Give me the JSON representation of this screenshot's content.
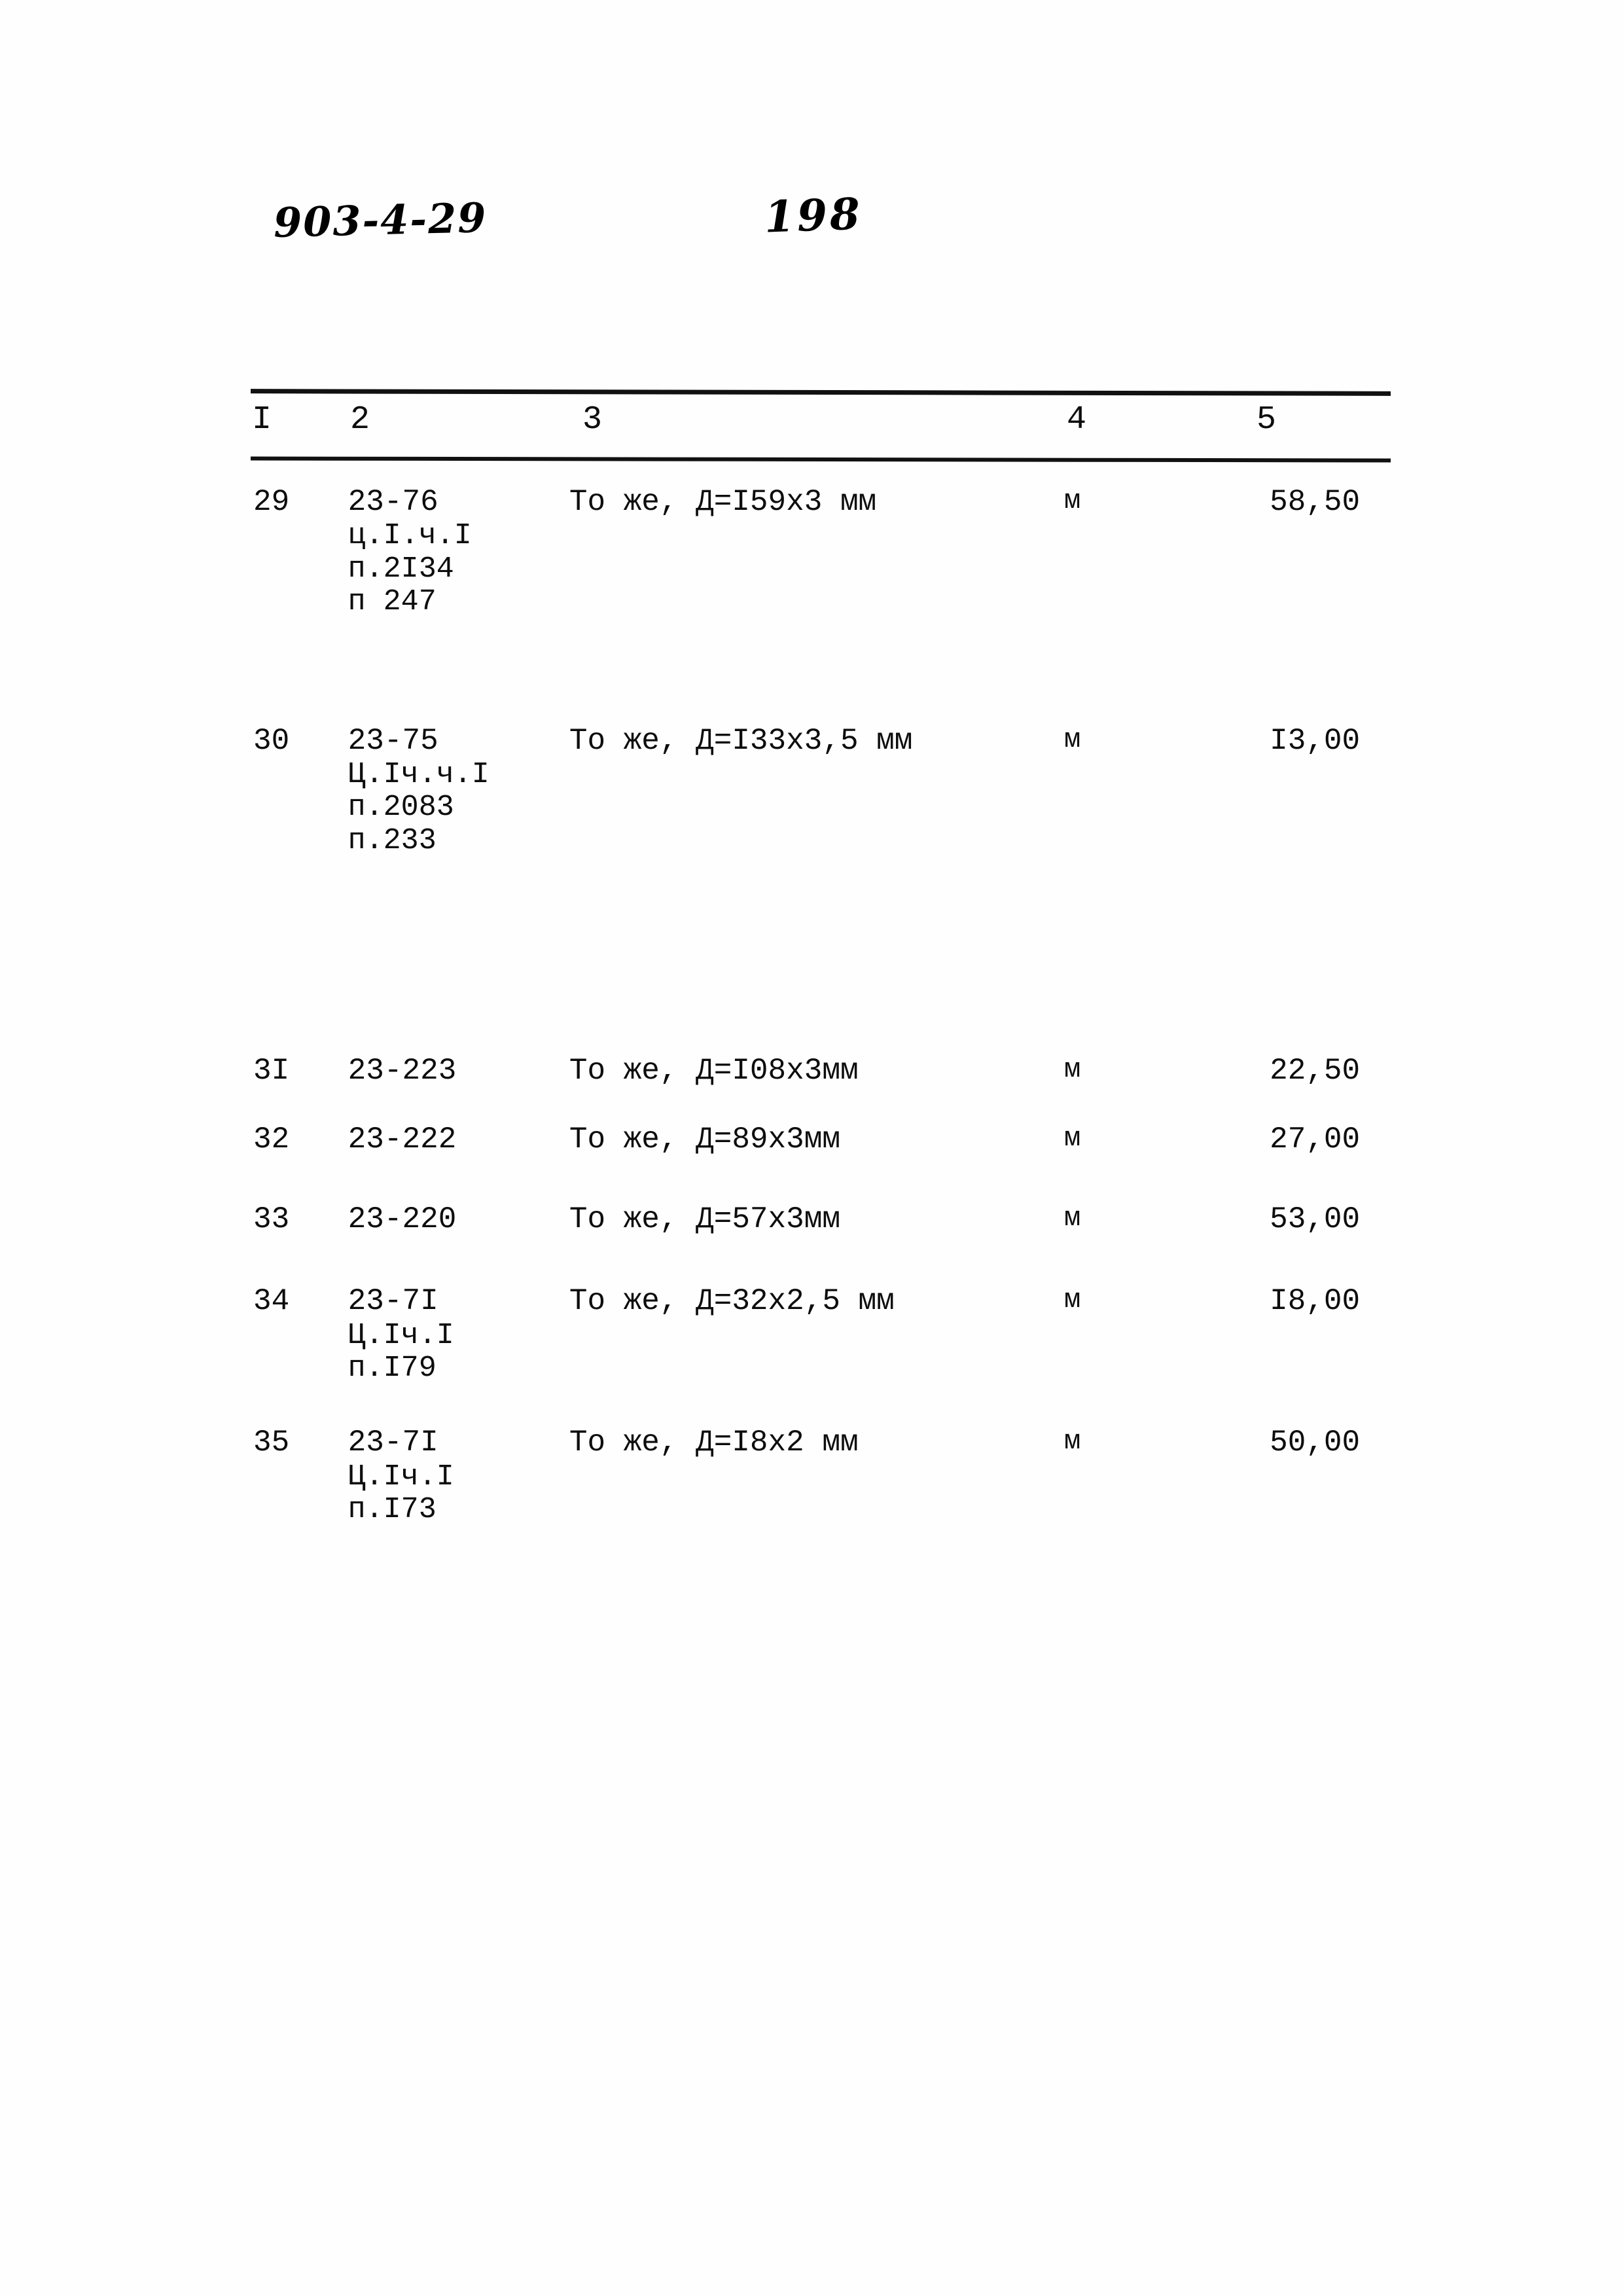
{
  "annotations": {
    "doc_code": "903-4-29",
    "page_number": "198"
  },
  "table": {
    "headers": [
      "I",
      "2",
      "3",
      "4",
      "5"
    ],
    "rows": [
      {
        "num": "29",
        "code": "23-76",
        "code_sub": "ц.I.ч.I\nп.2I34\nп 247",
        "desc": "То  же,  Д=I59х3  мм",
        "unit": "м",
        "qty": "58,50"
      },
      {
        "num": "30",
        "code": "23-75",
        "code_sub": "Ц.Iч.ч.I\nп.2083\nп.233",
        "desc": "То  же,  Д=I33х3,5  мм",
        "unit": "м",
        "qty": "I3,00"
      },
      {
        "num": "3I",
        "code": "23-223",
        "code_sub": "",
        "desc": "То  же,  Д=I08х3мм",
        "unit": "м",
        "qty": "22,50"
      },
      {
        "num": "32",
        "code": "23-222",
        "code_sub": "",
        "desc": "То  же,  Д=89х3мм",
        "unit": "м",
        "qty": "27,00"
      },
      {
        "num": "33",
        "code": "23-220",
        "code_sub": "",
        "desc": "То  же,  Д=57х3мм",
        "unit": "м",
        "qty": "53,00"
      },
      {
        "num": "34",
        "code": "23-7I",
        "code_sub": "Ц.Iч.I\nп.I79",
        "desc": "То  же,  Д=32х2,5  мм",
        "unit": "м",
        "qty": "I8,00"
      },
      {
        "num": "35",
        "code": "23-7I",
        "code_sub": "Ц.Iч.I\nп.I73",
        "desc": "То  же,  Д=I8х2  мм",
        "unit": "м",
        "qty": "50,00"
      }
    ]
  }
}
